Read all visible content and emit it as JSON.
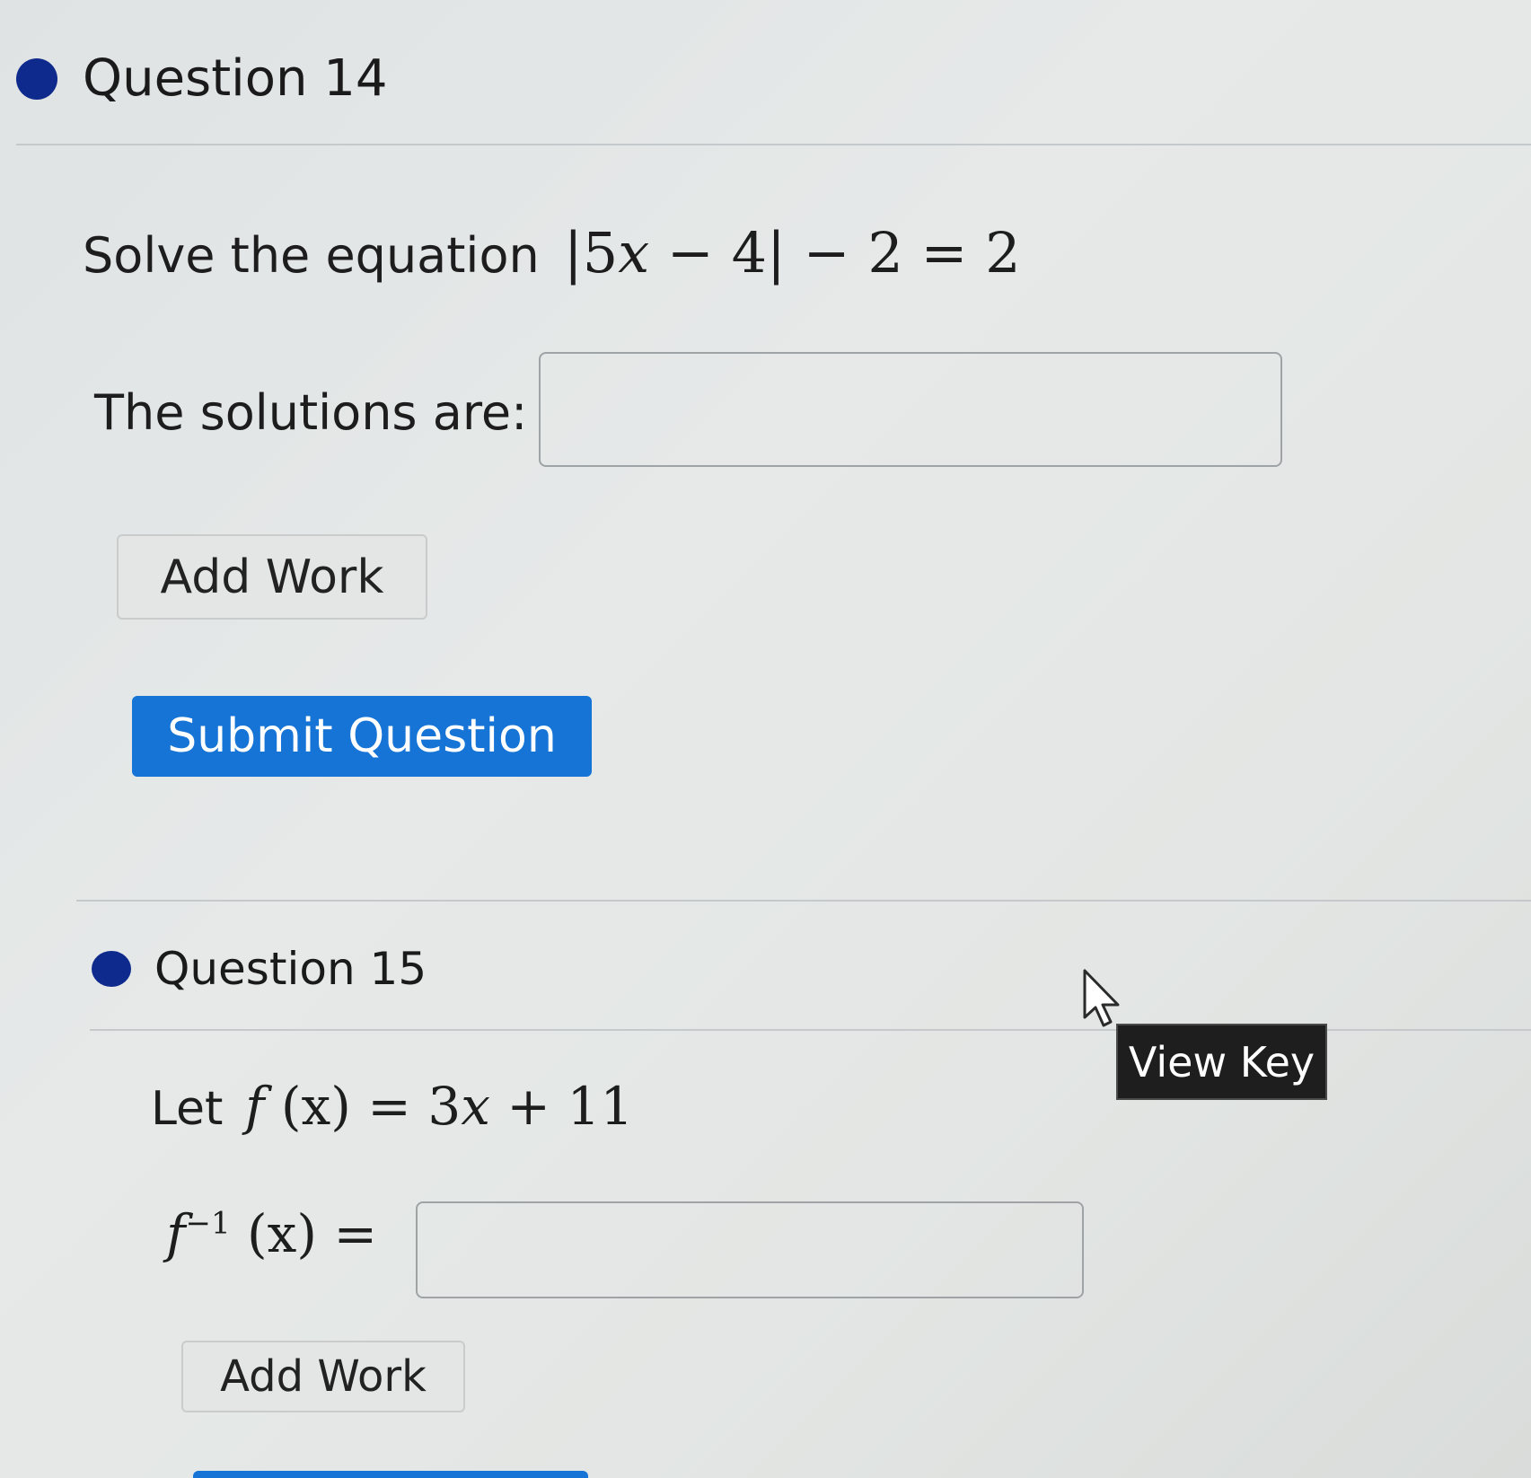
{
  "question14": {
    "title": "Question 14",
    "prompt_prefix": "Solve the equation",
    "equation": {
      "open_bar": "|",
      "coef": "5",
      "var": "x",
      "minus1": "−",
      "four": "4",
      "close_bar": "|",
      "minus2": "−",
      "two": "2",
      "equals": "=",
      "rhs": "2"
    },
    "answer_label": "The solutions are:",
    "answer_value": "",
    "add_work_label": "Add Work",
    "submit_label": "Submit Question"
  },
  "question15": {
    "title": "Question 15",
    "let_prefix": "Let",
    "function_def": {
      "f": "f",
      "arg": "(x)",
      "equals": "=",
      "rhs_coef": "3",
      "rhs_var": "x",
      "plus": "+",
      "rhs_const": "11"
    },
    "inverse_label": {
      "f": "f",
      "sup": "−1",
      "arg": "(x)",
      "equals": "="
    },
    "answer_value": "",
    "add_work_label": "Add Work",
    "view_key_label": "View Key"
  },
  "colors": {
    "dot": "#0d2a8c",
    "submit": "#1574d6",
    "view_key": "#1e1e1e"
  }
}
